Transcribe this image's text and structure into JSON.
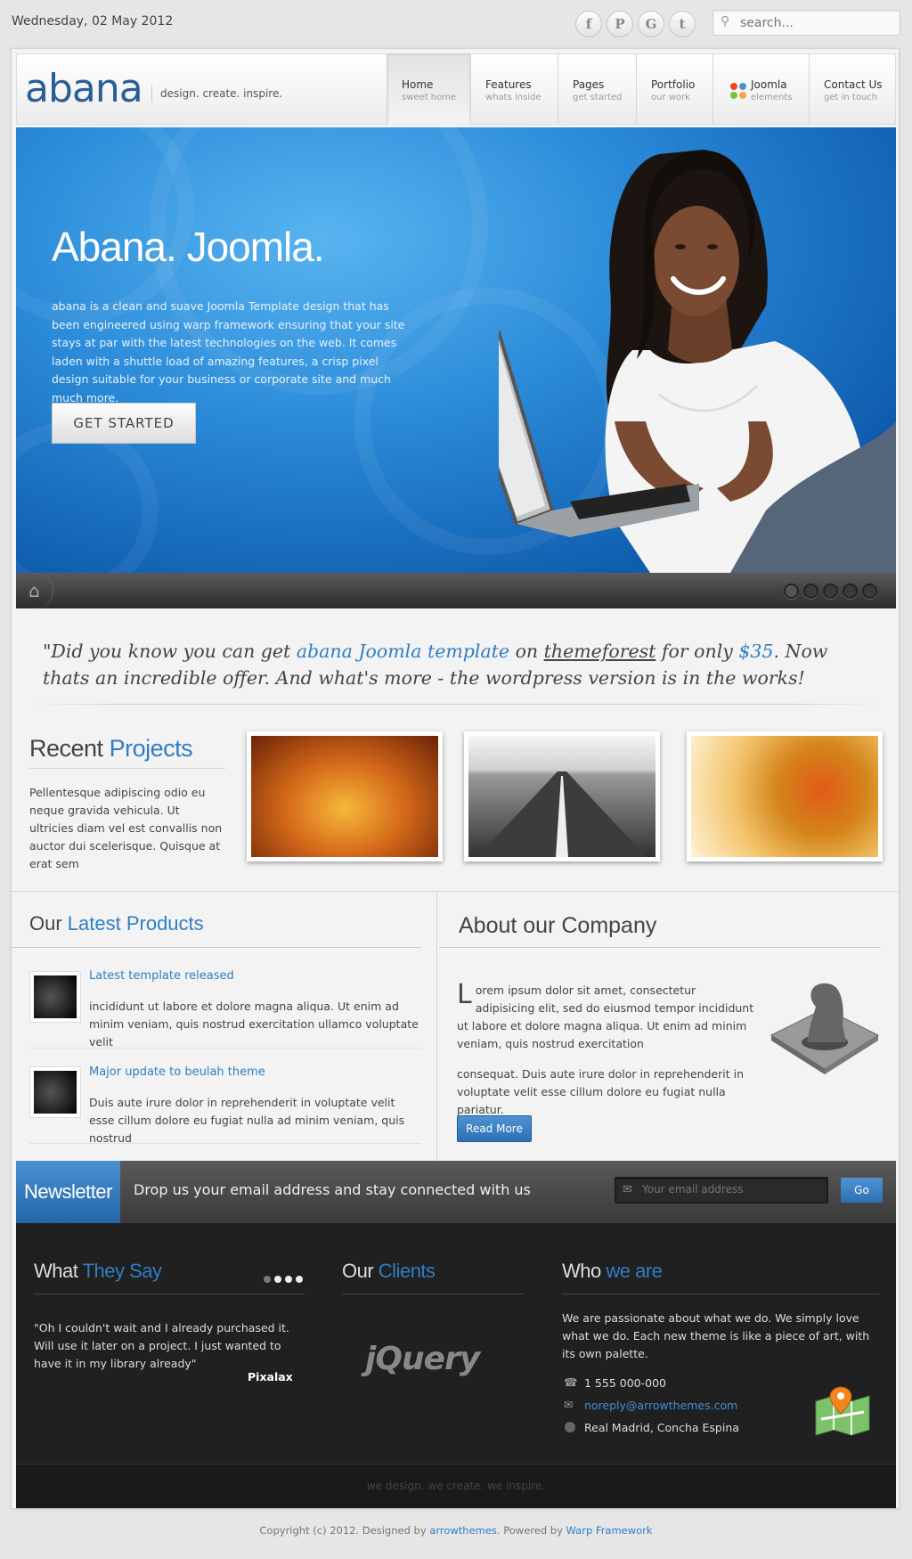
{
  "topbar": {
    "date": "Wednesday, 02 May 2012",
    "social": [
      {
        "icon": "facebook-icon",
        "glyph": "f"
      },
      {
        "icon": "pinterest-icon",
        "glyph": "P"
      },
      {
        "icon": "google-icon",
        "glyph": "G"
      },
      {
        "icon": "twitter-icon",
        "glyph": "t"
      }
    ],
    "search_placeholder": "search..."
  },
  "header": {
    "logo": "abana",
    "tagline": "design. create. inspire.",
    "nav": [
      {
        "label": "Home",
        "sub": "sweet home",
        "active": true
      },
      {
        "label": "Features",
        "sub": "whats inside"
      },
      {
        "label": "Pages",
        "sub": "get started"
      },
      {
        "label": "Portfolio",
        "sub": "our work"
      },
      {
        "label": "Joomla",
        "sub": "elements",
        "icon": "joomla-icon"
      },
      {
        "label": "Contact Us",
        "sub": "get in touch"
      }
    ]
  },
  "hero": {
    "title": "Abana. Joomla.",
    "text": "abana is a clean and suave Joomla Template design that has been engineered using warp framework ensuring that your site stays at par with the latest technologies on the web. It comes laden with a shuttle load of amazing features, a crisp pixel design suitable for your business or corporate site and much much more.",
    "button": "GET STARTED",
    "slides": 5,
    "active_slide": 1
  },
  "quote": {
    "p1": "\"Did you know you can get ",
    "link1": "abana Joomla template",
    "p2": " on ",
    "link2": "themeforest",
    "p3": " for only ",
    "price": "$35",
    "p4": ". Now thats an incredible offer. And what's more - the wordpress version is in the works!"
  },
  "recent_projects": {
    "title_a": "Recent ",
    "title_b": "Projects",
    "text": "Pellentesque adipiscing odio eu neque gravida vehicula. Ut ultricies diam vel est convallis non auctor dui scelerisque. Quisque at erat sem"
  },
  "products": {
    "title_a": "Our ",
    "title_b": "Latest Products",
    "items": [
      {
        "title": "Latest template released",
        "text": "incididunt ut labore et dolore magna aliqua. Ut enim ad minim veniam, quis nostrud exercitation ullamco voluptate velit"
      },
      {
        "title": "Major update to beulah theme",
        "text": "Duis aute irure dolor in reprehenderit in voluptate velit esse cillum dolore eu fugiat nulla ad minim veniam, quis nostrud"
      }
    ]
  },
  "about": {
    "title": "About our Company",
    "drop": "L",
    "p1": "orem ipsum dolor sit amet, consectetur adipisicing elit, sed do eiusmod tempor incididunt ut labore et dolore magna aliqua. Ut enim ad minim veniam, quis nostrud exercitation",
    "p2": "consequat. Duis aute irure dolor in reprehenderit in voluptate velit esse cillum dolore eu fugiat nulla pariatur.",
    "button": "Read More"
  },
  "newsletter": {
    "label": "Newsletter",
    "text": "Drop us your email address and stay connected with us",
    "placeholder": "Your email address",
    "button": "Go"
  },
  "footer": {
    "say_title_a": "What ",
    "say_title_b": "They Say",
    "testimonial": "\"Oh I couldn't wait and I already purchased it. Will use it later on a project. I just wanted to have it in my library already\"",
    "author": "Pixalax",
    "clients_title_a": "Our ",
    "clients_title_b": "Clients",
    "client_logo": "jQuery",
    "who_title_a": "Who ",
    "who_title_b": "we are",
    "who_text": "We are passionate about what we do. We simply love what we do. Each new theme is like a piece of art, with its own palette.",
    "phone": "1 555 000-000",
    "email": "noreply@arrowthemes.com",
    "address": "Real Madrid, Concha Espina",
    "bottom": "we design. we create. we inspire."
  },
  "copyright": {
    "pre": "Copyright (c) 2012. Designed by ",
    "link1": "arrowthemes",
    "mid": ". Powered by ",
    "link2": "Warp Framework"
  }
}
